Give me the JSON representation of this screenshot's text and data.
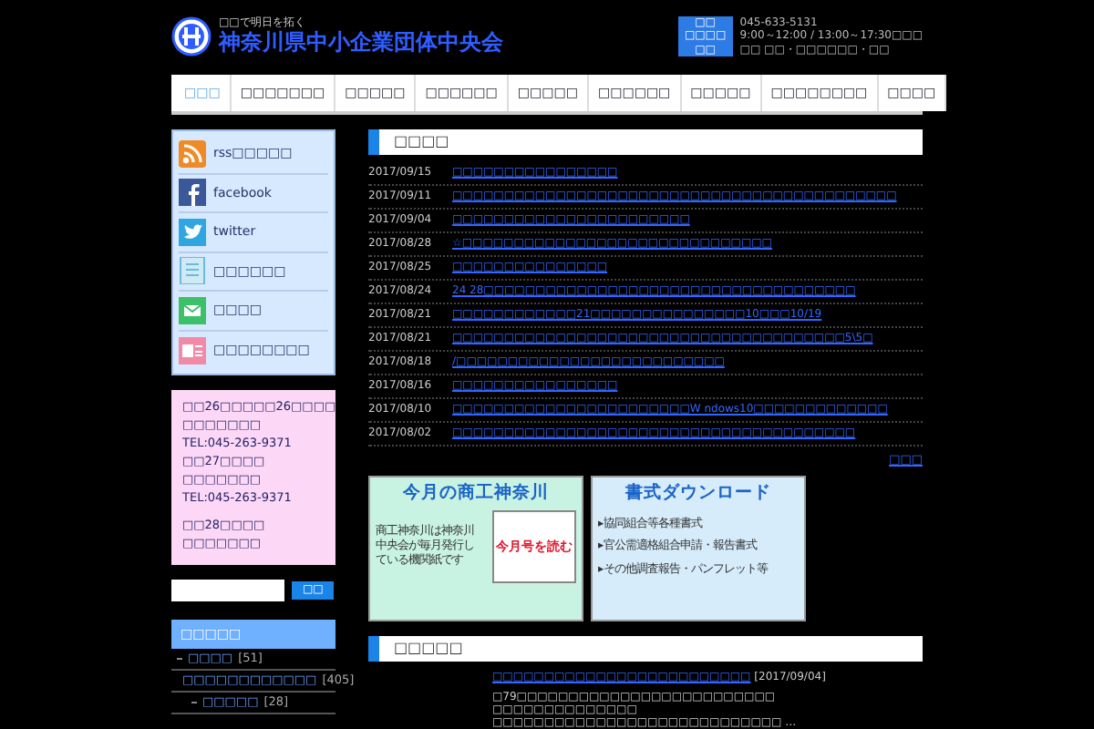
{
  "header": {
    "tagline": "□□で明日を拓く",
    "title": "神奈川県中小企業団体中央会",
    "contacts": [
      {
        "label": "□□",
        "value": "045-633-5131"
      },
      {
        "label": "□□□□",
        "value": "9:00～12:00 / 13:00～17:30□□□"
      },
      {
        "label": "□□",
        "value": "□□ □□・□□□□□□・□□"
      }
    ]
  },
  "nav": [
    {
      "label": "□□□",
      "selected": true
    },
    {
      "label": "□□□□□□□",
      "selected": false
    },
    {
      "label": "□□□□□",
      "selected": false
    },
    {
      "label": "□□□□□□",
      "selected": false
    },
    {
      "label": "□□□□□",
      "selected": false
    },
    {
      "label": "□□□□□□",
      "selected": false
    },
    {
      "label": "□□□□□",
      "selected": false
    },
    {
      "label": "□□□□□□□□",
      "selected": false
    },
    {
      "label": "□□□□",
      "selected": false
    }
  ],
  "sidebar": {
    "links": [
      {
        "kind": "rss",
        "label": "rss□□□□□"
      },
      {
        "kind": "facebook",
        "label": "facebook"
      },
      {
        "kind": "twitter",
        "label": "twitter"
      },
      {
        "kind": "doc",
        "label": "□□□□□□"
      },
      {
        "kind": "mail",
        "label": "□□□□"
      },
      {
        "kind": "card",
        "label": "□□□□□□□□"
      }
    ],
    "notice": [
      [
        "□□26□□□□□26□□□□",
        "□□□□□□□",
        "TEL:045-263-9371",
        "□□27□□□□",
        "□□□□□□□",
        "TEL:045-263-9371"
      ],
      [
        "□□28□□□□",
        "□□□□□□□"
      ]
    ],
    "search_button": "□□",
    "category_title": "□□□□□",
    "categories": [
      {
        "label": "□□□□",
        "count": "[51]"
      },
      {
        "label": "□□□□□□□□□□□□",
        "count": "[405]",
        "children": [
          {
            "label": "□□□□□",
            "count": "[28]"
          }
        ]
      }
    ]
  },
  "news": {
    "title": "□□□□",
    "items": [
      {
        "date": "2017/09/15",
        "text": "□□□□□□□□□□□□□□□□"
      },
      {
        "date": "2017/09/11",
        "text": "□□□□□□□□□□□□□□□□□□□□□□□□□□□□□□□□□□□□□□□□□□□"
      },
      {
        "date": "2017/09/04",
        "text": "□□□□□□□□□□□□□□□□□□□□□□□"
      },
      {
        "date": "2017/08/28",
        "text": "☆□□□□□□□□□□□□□□□□□□□□□□□□□□□□□□"
      },
      {
        "date": "2017/08/25",
        "text": "□□□□□□□□□□□□□□□"
      },
      {
        "date": "2017/08/24",
        "text": "24 28□□□□□□□□□□□□□□□□□□□□□□□□□□□□□□□□□□□□"
      },
      {
        "date": "2017/08/21",
        "text": "□□□□□□□□□□□□21□□□□□□□□□□□□□□□10□□□10/19"
      },
      {
        "date": "2017/08/21",
        "text": "□□□□□□□□□□□□□□□□□□□□□□□□□□□□□□□□□□□□□□5\\5□"
      },
      {
        "date": "2017/08/18",
        "text": "/□□□□□□□□□□□□□□□□□□□□□□□□□□"
      },
      {
        "date": "2017/08/16",
        "text": "□□□□□□□□□□□□□□□□"
      },
      {
        "date": "2017/08/10",
        "text": "□□□□□□□□□□□□□□□□□□□□□□□W ndows10□□□□□□□□□□□□□"
      },
      {
        "date": "2017/08/02",
        "text": "□□□□□□□□□□□□□□□□□□□□□□□□□□□□□□□□□□□□□□□"
      }
    ],
    "more": "□□□"
  },
  "banners": [
    {
      "kind": "magazine",
      "title": "今月の商工神奈川",
      "text": "商工神奈川は神奈川中央会が毎月発行している機関紙です",
      "book": "今月号を読む"
    },
    {
      "kind": "download",
      "title": "書式ダウンロード",
      "items": [
        "▸協同組合等各種書式",
        "▸官公需適格組合申請・報告書式",
        "▸その他調査報告・パンフレット等"
      ]
    }
  ],
  "section2": {
    "title": "□□□□□",
    "link": "□□□□□□□□□□□□□□□□□□□□□□□□□",
    "date": "[2017/09/04]",
    "body": "□79□□□□□□□□□□□□□□□□□□□□□□□□□ □□□□□□□□□□□□□□ □□□□□□□□□□□□□□□□□□□□□□□□□□□□ …"
  }
}
